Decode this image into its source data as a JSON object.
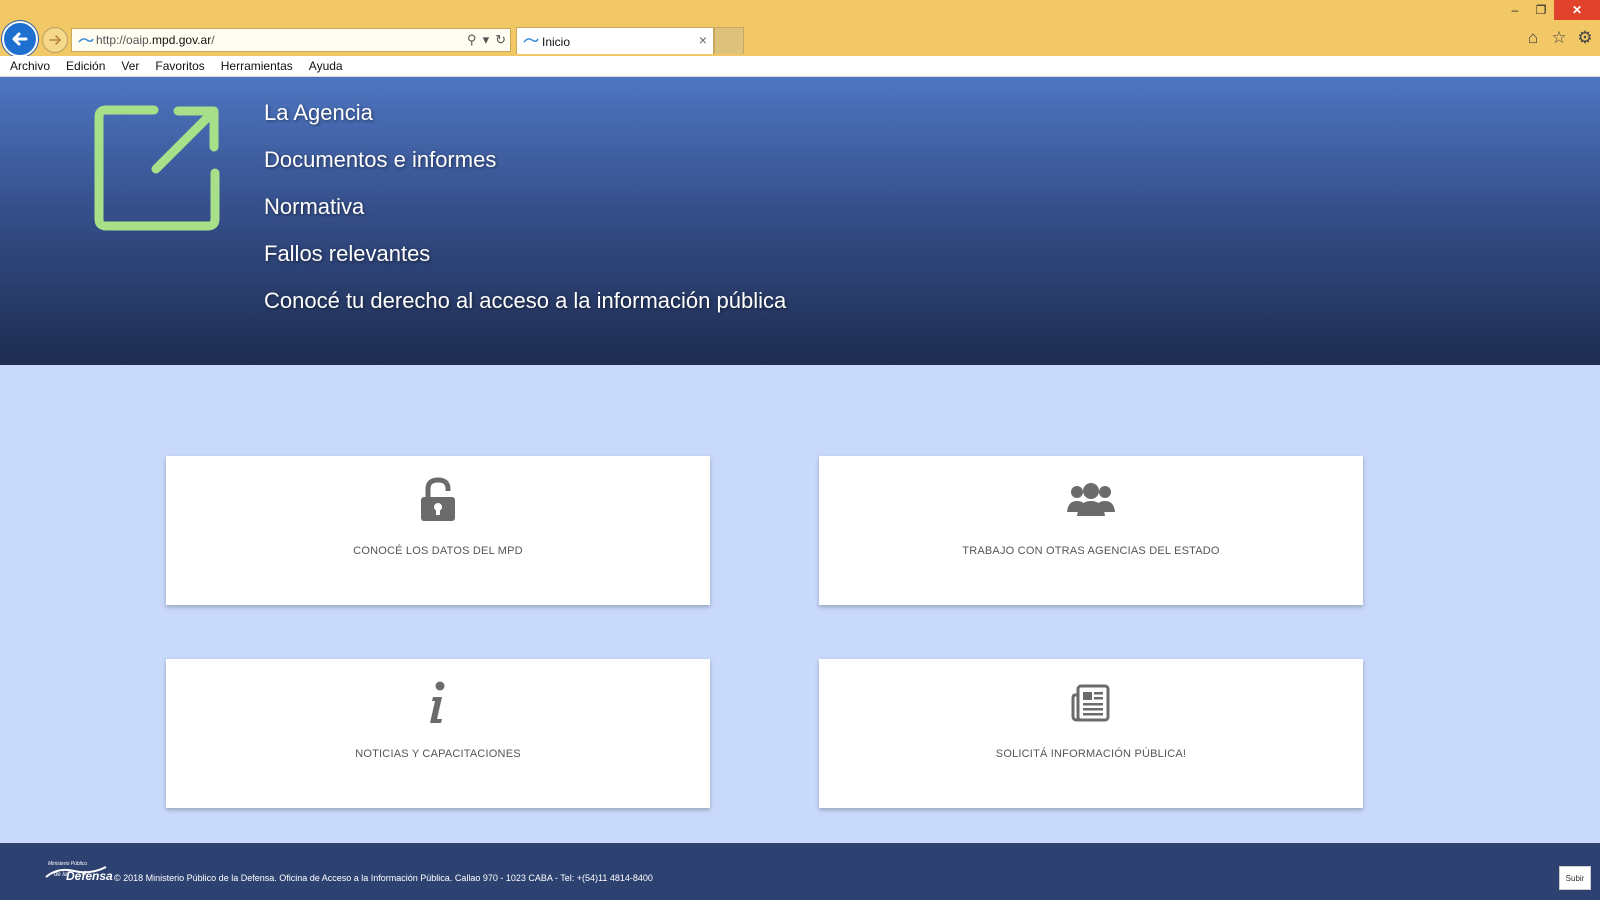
{
  "browser": {
    "url_prefix": "http://oaip.",
    "url_domain": "mpd.gov.ar",
    "url_suffix": "/",
    "tab_title": "Inicio",
    "tab_close": "×",
    "window_controls": {
      "minimize": "–",
      "restore": "❐",
      "close": "✕"
    },
    "toolbar_icons": [
      "home-icon",
      "star-icon",
      "gear-icon"
    ]
  },
  "menu": [
    "Archivo",
    "Edición",
    "Ver",
    "Favoritos",
    "Herramientas",
    "Ayuda"
  ],
  "hero": {
    "links": [
      "La Agencia",
      "Documentos e informes",
      "Normativa",
      "Fallos relevantes",
      "Conocé tu derecho al acceso a la información pública"
    ],
    "icon_color": "#a8e08a"
  },
  "cards": [
    {
      "label": "CONOCÉ LOS DATOS DEL MPD",
      "icon": "unlock-icon"
    },
    {
      "label": "TRABAJO CON OTRAS AGENCIAS DEL ESTADO",
      "icon": "users-icon"
    },
    {
      "label": "NOTICIAS Y CAPACITACIONES",
      "icon": "info-icon"
    },
    {
      "label": "SOLICITÁ INFORMACIÓN PÚBLICA!",
      "icon": "newspaper-icon"
    }
  ],
  "footer": {
    "logo_line1": "Ministerio Público",
    "logo_line2": "de la",
    "logo_line3": "Defensa",
    "copyright": "© 2018 Ministerio Público de la Defensa. Oficina de Acceso a la Información Pública. Callao 970 - 1023 CABA - Tel: +(54)11 4814-8400",
    "up_button": "Subir"
  },
  "colors": {
    "chrome": "#f2c766",
    "hero_top": "#4e76c2",
    "hero_bottom": "#1e2c50",
    "body": "#c9d9fb",
    "footer": "#2e4272",
    "card_icon": "#6b6b6b"
  }
}
